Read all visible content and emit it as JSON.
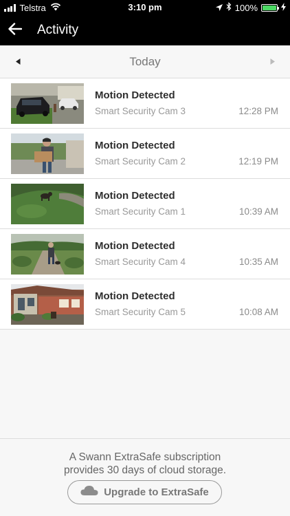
{
  "status_bar": {
    "carrier": "Telstra",
    "time": "3:10 pm",
    "battery": "100%",
    "battery_level": 1.0,
    "battery_color": "#4cd964"
  },
  "nav": {
    "title": "Activity",
    "back_icon": "arrow-left-icon"
  },
  "date_bar": {
    "label": "Today",
    "prev_icon": "caret-left-icon",
    "next_icon": "caret-right-icon"
  },
  "events": [
    {
      "title": "Motion Detected",
      "camera": "Smart Security Cam 3",
      "time": "12:28 PM",
      "thumbnail": "driveway-car"
    },
    {
      "title": "Motion Detected",
      "camera": "Smart Security Cam 2",
      "time": "12:19 PM",
      "thumbnail": "person-with-package"
    },
    {
      "title": "Motion Detected",
      "camera": "Smart Security Cam 1",
      "time": "10:39 AM",
      "thumbnail": "lawn-dog"
    },
    {
      "title": "Motion Detected",
      "camera": "Smart Security Cam 4",
      "time": "10:35 AM",
      "thumbnail": "garden-path-person"
    },
    {
      "title": "Motion Detected",
      "camera": "Smart Security Cam 5",
      "time": "10:08 AM",
      "thumbnail": "house-porch"
    }
  ],
  "footer": {
    "line1": "A Swann ExtraSafe subscription",
    "line2": "provides 30 days of cloud storage.",
    "button_label": "Upgrade to ExtraSafe",
    "button_icon": "cloud-icon"
  }
}
